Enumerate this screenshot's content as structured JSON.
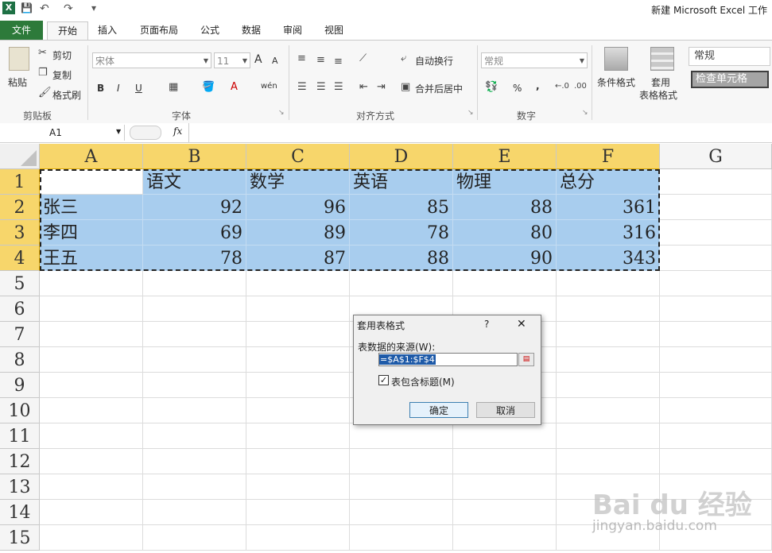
{
  "window": {
    "title": "新建 Microsoft Excel 工作"
  },
  "quick_access": {
    "excel": "X",
    "save": "💾",
    "undo": "↶",
    "redo": "↷",
    "customize": "▾"
  },
  "tabs": [
    {
      "label": "文件"
    },
    {
      "label": "开始"
    },
    {
      "label": "插入"
    },
    {
      "label": "页面布局"
    },
    {
      "label": "公式"
    },
    {
      "label": "数据"
    },
    {
      "label": "审阅"
    },
    {
      "label": "视图"
    }
  ],
  "ribbon": {
    "clipboard": {
      "label": "剪贴板",
      "paste": "粘贴",
      "cut": "剪切",
      "copy": "复制",
      "format_painter": "格式刷"
    },
    "font": {
      "label": "字体",
      "name": "宋体",
      "size": "11",
      "grow": "A",
      "shrink": "A",
      "bold": "B",
      "italic": "I",
      "underline": "U",
      "phonetic": "wén"
    },
    "alignment": {
      "label": "对齐方式",
      "wrap": "自动换行",
      "merge": "合并后居中"
    },
    "number": {
      "label": "数字",
      "format": "常规",
      "percent": "%",
      "comma": ","
    },
    "styles": {
      "conditional": "条件格式",
      "table_line1": "套用",
      "table_line2": "表格格式",
      "style_normal": "常规",
      "style_check": "检查单元格"
    }
  },
  "formula_bar": {
    "name_box": "A1",
    "fx": "fx",
    "value": ""
  },
  "columns": [
    "A",
    "B",
    "C",
    "D",
    "E",
    "F",
    "G"
  ],
  "rows": [
    "1",
    "2",
    "3",
    "4",
    "5",
    "6",
    "7",
    "8",
    "9",
    "10",
    "11",
    "12",
    "13",
    "14",
    "15"
  ],
  "table": [
    [
      "",
      "语文",
      "数学",
      "英语",
      "物理",
      "总分"
    ],
    [
      "张三",
      "92",
      "96",
      "85",
      "88",
      "361"
    ],
    [
      "李四",
      "69",
      "89",
      "78",
      "80",
      "316"
    ],
    [
      "王五",
      "78",
      "87",
      "88",
      "90",
      "343"
    ]
  ],
  "dialog": {
    "title": "套用表格式",
    "help": "?",
    "close": "✕",
    "source_label": "表数据的来源(W):",
    "source_value": "=$A$1:$F$4",
    "has_headers": "表包含标题(M)",
    "ok": "确定",
    "cancel": "取消"
  },
  "watermark": {
    "brand": "Bai du 经验",
    "url": "jingyan.baidu.com"
  },
  "colors": {
    "file_tab": "#2d7a3a",
    "selection": "#a8cdee",
    "header_selected": "#f7d66b"
  }
}
